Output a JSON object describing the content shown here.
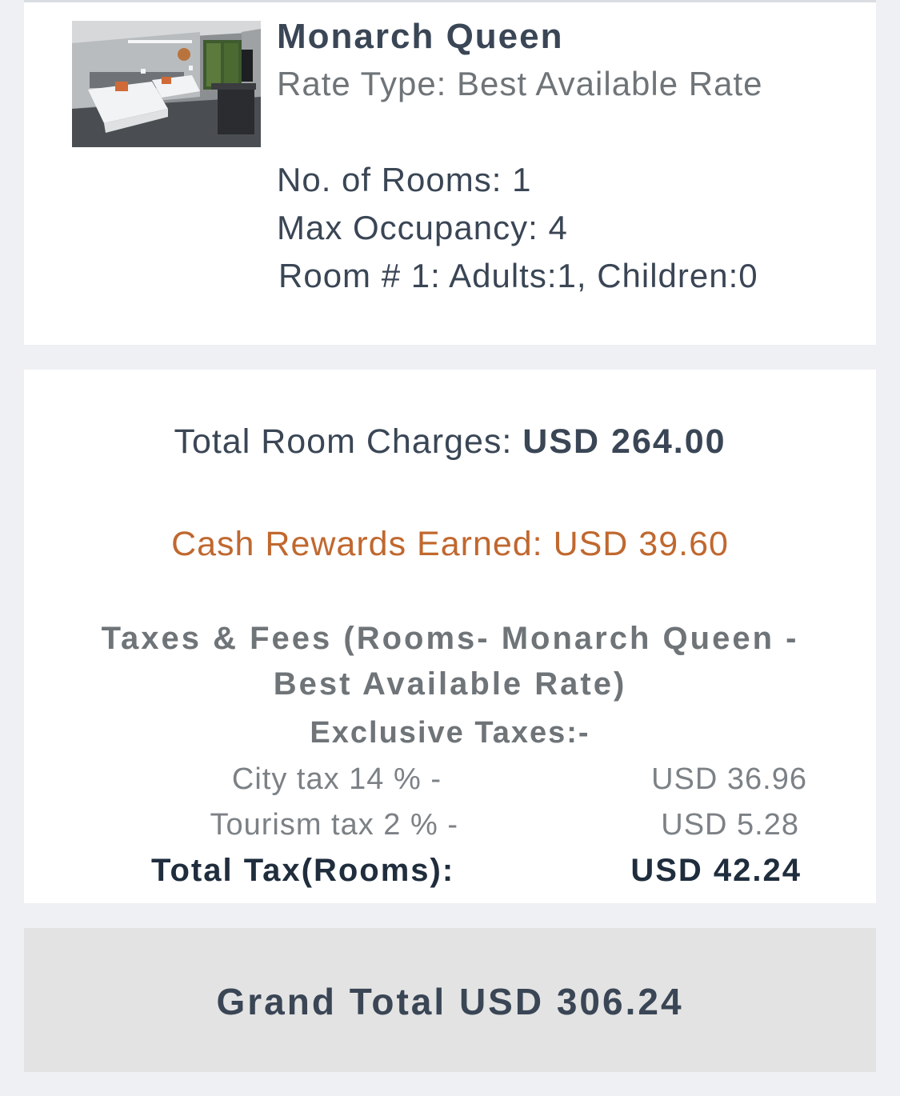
{
  "room": {
    "image_icon": "hotel-room-photo",
    "title": "Monarch Queen",
    "rate_type": "Rate Type: Best Available Rate",
    "no_of_rooms": "No. of Rooms: 1",
    "max_occupancy": "Max Occupancy: 4",
    "guests": "Room # 1: Adults:1, Children:0"
  },
  "charges": {
    "total_room_label": "Total Room Charges: ",
    "total_room_value": "USD 264.00",
    "cash_rewards": "Cash Rewards Earned: USD 39.60",
    "taxes_title_line1": "Taxes & Fees (Rooms- Monarch Queen -",
    "taxes_title_line2": "Best Available Rate)",
    "exclusive_taxes": "Exclusive Taxes:-",
    "taxes": [
      {
        "label": "City tax 14 % -",
        "amount": "USD 36.96"
      },
      {
        "label": "Tourism tax 2 % -",
        "amount": "USD 5.28"
      }
    ],
    "total_tax_label": "Total Tax(Rooms):",
    "total_tax_amount": "USD 42.24"
  },
  "grand_total": "Grand Total USD 306.24",
  "colors": {
    "background": "#eef0f3",
    "primary_text": "#3a4655",
    "muted_text": "#6f7478",
    "rewards": "#c0682f",
    "total_bar": "#e3e3e3"
  }
}
